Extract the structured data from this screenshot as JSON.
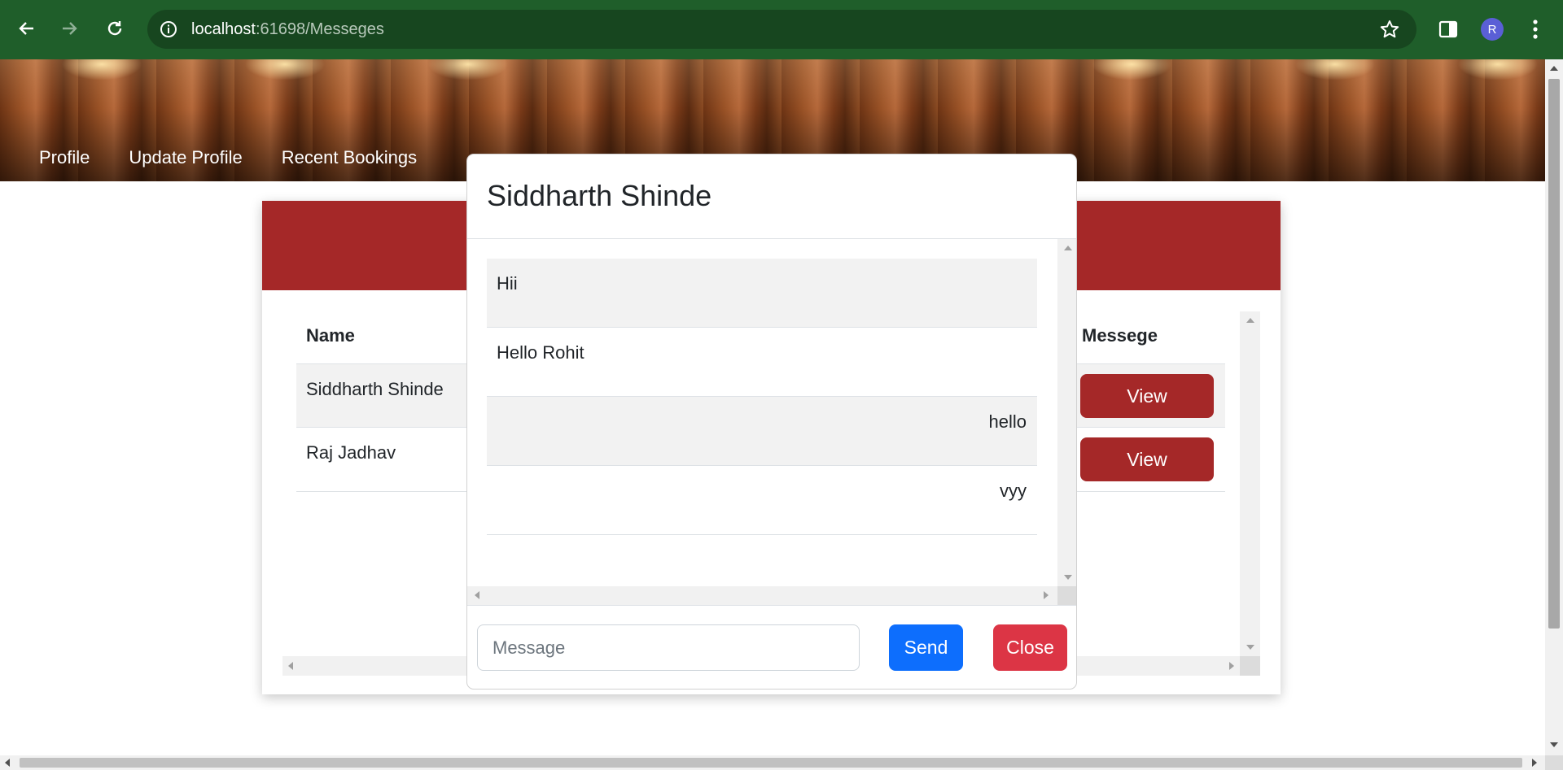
{
  "browser": {
    "url_host": "localhost",
    "url_rest": ":61698/Messeges",
    "profile_initial": "R"
  },
  "nav": {
    "items": [
      {
        "label": "Profile"
      },
      {
        "label": "Update Profile"
      },
      {
        "label": "Recent Bookings"
      }
    ]
  },
  "table": {
    "headers": {
      "name": "Name",
      "message": "Messege"
    },
    "rows": [
      {
        "name": "Siddharth Shinde",
        "action": "View"
      },
      {
        "name": "Raj Jadhav",
        "action": "View"
      }
    ]
  },
  "modal": {
    "title": "Siddharth Shinde",
    "messages": [
      {
        "text": "Hii",
        "align": "left"
      },
      {
        "text": "Hello Rohit",
        "align": "left"
      },
      {
        "text": "hello",
        "align": "right"
      },
      {
        "text": "vyy",
        "align": "right"
      }
    ],
    "input_placeholder": "Message",
    "send_label": "Send",
    "close_label": "Close"
  },
  "colors": {
    "chrome": "#1f5e2a",
    "brand_red": "#a52828",
    "send_blue": "#0d6efd",
    "close_red": "#dc3545"
  }
}
